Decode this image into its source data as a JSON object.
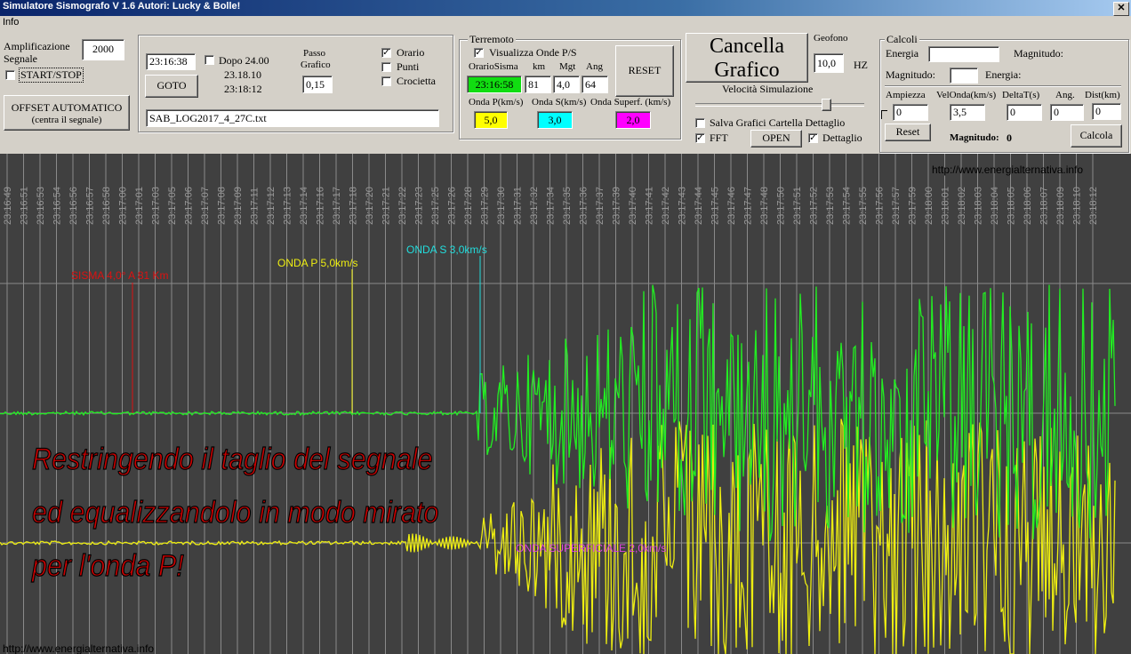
{
  "window": {
    "title": "Simulatore Sismografo V 1.6  Autori: Lucky & Bolle!",
    "close_glyph": "✕"
  },
  "menu": {
    "info": "Info"
  },
  "amplification": {
    "label": "Amplificazione Segnale",
    "value": "2000",
    "startstop": "START/STOP",
    "offset_line1": "OFFSET AUTOMATICO",
    "offset_line2": "(centra il segnale)"
  },
  "timebox": {
    "time": "23:16:38",
    "dopo_label": "Dopo 24.00",
    "t1": "23.18.10",
    "t2": "23:18:12",
    "goto": "GOTO",
    "passo_line1": "Passo",
    "passo_line2": "Grafico",
    "passo_value": "0,15",
    "orario": "Orario",
    "punti": "Punti",
    "crocietta": "Crocietta",
    "file": "SAB_LOG2017_4_27C.txt"
  },
  "terremoto": {
    "title": "Terremoto",
    "visualizza": "Visualizza Onde P/S",
    "h_orario": "OrarioSisma",
    "h_km": "km",
    "h_mgt": "Mgt",
    "h_ang": "Ang",
    "orario": "23:16:58",
    "km": "81",
    "mgt": "4,0",
    "ang": "64",
    "reset": "RESET",
    "onda_p_label": "Onda P(km/s)",
    "onda_s_label": "Onda S(km/s)",
    "onda_sup_label": "Onda Superf. (km/s)",
    "onda_p": "5,0",
    "onda_s": "3,0",
    "onda_sup": "2,0"
  },
  "controls": {
    "cancella_line1": "Cancella",
    "cancella_line2": "Grafico",
    "geofono": "Geofono",
    "geofono_value": "10,0",
    "hz": "HZ",
    "velocita": "Velocità Simulazione",
    "salva": "Salva Grafici Cartella Dettaglio",
    "fft": "FFT",
    "open": "OPEN",
    "dettaglio": "Dettaglio"
  },
  "calcoli": {
    "title": "Calcoli",
    "energia": "Energia",
    "magnitudo1": "Magnitudo:",
    "magnitudo2": "Magnitudo:",
    "energia2": "Energia:",
    "h_ampiezza": "Ampiezza",
    "h_velonda": "VelOnda(km/s)",
    "h_deltat": "DeltaT(s)",
    "h_ang": "Ang.",
    "h_dist": "Dist(km)",
    "ampiezza": "0",
    "velonda": "3,5",
    "deltat": "0",
    "ang": "0",
    "dist": "0",
    "reset": "Reset",
    "magnitudo_result_label": "Magnitudo:",
    "magnitudo_result": "0",
    "calcola": "Calcola"
  },
  "plot": {
    "website_top": "http://www.energialternativa.info",
    "website_bottom": "http://www.energialternativa.info",
    "marker_sisma": "SISMA 4,0° A 81 Km",
    "marker_p": "ONDA P 5,0km/s",
    "marker_s": "ONDA S 3,0km/s",
    "marker_sup": "ONDA SUPERFICIALE 2,0km/s",
    "overlay_line1": "Restringendo il taglio del segnale",
    "overlay_line2": "ed  equalizzandolo in modo mirato",
    "overlay_line3": "per l'onda P!",
    "time_labels": [
      "23:16:49",
      "23:16:51",
      "23:16:53",
      "23:16:54",
      "23:16:56",
      "23:16:57",
      "23:16:58",
      "23:17:00",
      "23:17:01",
      "23:17:03",
      "23:17:05",
      "23:17:06",
      "23:17:07",
      "23:17:08",
      "23:17:09",
      "23:17:11",
      "23:17:12",
      "23:17:13",
      "23:17:14",
      "23:17:16",
      "23:17:17",
      "23:17:18",
      "23:17:20",
      "23:17:21",
      "23:17:22",
      "23:17:23",
      "23:17:25",
      "23:17:26",
      "23:17:28",
      "23:17:29",
      "23:17:30",
      "23:17:31",
      "23:17:32",
      "23:17:34",
      "23:17:35",
      "23:17:36",
      "23:17:37",
      "23:17:39",
      "23:17:40",
      "23:17:41",
      "23:17:42",
      "23:17:43",
      "23:17:44",
      "23:17:45",
      "23:17:46",
      "23:17:47",
      "23:17:48",
      "23:17:50",
      "23:17:51",
      "23:17:52",
      "23:17:53",
      "23:17:54",
      "23:17:55",
      "23:17:56",
      "23:17:57",
      "23:17:59",
      "23:18:00",
      "23:18:01",
      "23:18:02",
      "23:18:03",
      "23:18:04",
      "23:18:05",
      "23:18:06",
      "23:18:07",
      "23:18:09",
      "23:18:10",
      "23:18:12"
    ],
    "colors": {
      "green": "#22ee22",
      "yellow": "#eeee11",
      "red": "#dd1111",
      "cyan": "#22dddd",
      "magenta": "#dd44dd",
      "grid": "#808080"
    }
  }
}
